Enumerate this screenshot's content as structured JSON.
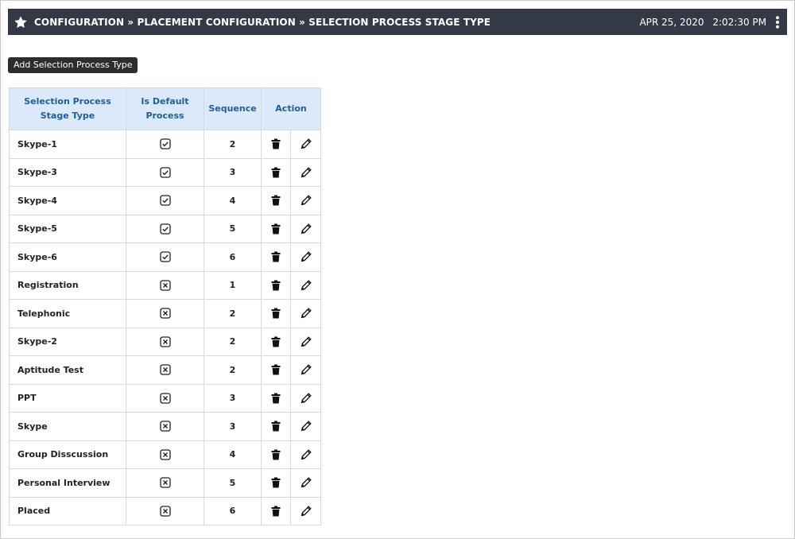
{
  "header": {
    "breadcrumb": "CONFIGURATION » PLACEMENT CONFIGURATION » SELECTION PROCESS STAGE TYPE",
    "date": "APR 25, 2020",
    "time": "2:02:30 PM"
  },
  "toolbar": {
    "add_label": "Add Selection Process Type"
  },
  "table": {
    "columns": [
      "Selection Process Stage Type",
      "Is Default Process",
      "Sequence",
      "Action"
    ],
    "rows": [
      {
        "name": "Skype-1",
        "is_default": true,
        "sequence": "2"
      },
      {
        "name": "Skype-3",
        "is_default": true,
        "sequence": "3"
      },
      {
        "name": "Skype-4",
        "is_default": true,
        "sequence": "4"
      },
      {
        "name": "Skype-5",
        "is_default": true,
        "sequence": "5"
      },
      {
        "name": "Skype-6",
        "is_default": true,
        "sequence": "6"
      },
      {
        "name": "Registration",
        "is_default": false,
        "sequence": "1"
      },
      {
        "name": "Telephonic",
        "is_default": false,
        "sequence": "2"
      },
      {
        "name": "Skype-2",
        "is_default": false,
        "sequence": "2"
      },
      {
        "name": "Aptitude Test",
        "is_default": false,
        "sequence": "2"
      },
      {
        "name": "PPT",
        "is_default": false,
        "sequence": "3"
      },
      {
        "name": "Skype",
        "is_default": false,
        "sequence": "3"
      },
      {
        "name": "Group Disscussion",
        "is_default": false,
        "sequence": "4"
      },
      {
        "name": "Personal Interview",
        "is_default": false,
        "sequence": "5"
      },
      {
        "name": "Placed",
        "is_default": false,
        "sequence": "6"
      }
    ]
  },
  "icons": {
    "star": "star-icon",
    "menu": "kebab-menu-icon",
    "checked": "checkbox-checked-icon",
    "unchecked": "checkbox-x-icon",
    "delete": "trash-icon",
    "edit": "pencil-icon"
  },
  "colors": {
    "topbar_bg": "#343a45",
    "header_bg": "#dbe9fb",
    "header_text": "#1d5e9c",
    "button_bg": "#2d2d2d"
  }
}
